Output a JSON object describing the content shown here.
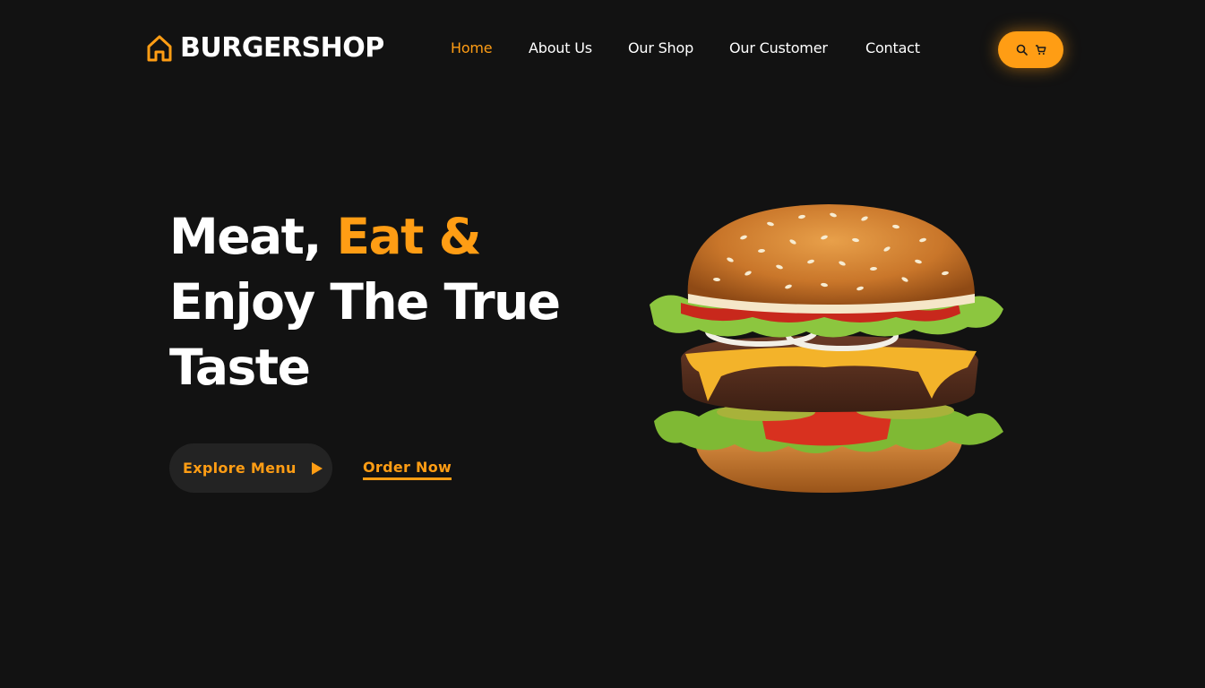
{
  "brand": {
    "name": "BURGERSHOP",
    "icon": "home-icon",
    "accent_color": "#ff9d14"
  },
  "nav": {
    "items": [
      {
        "label": "Home",
        "active": true
      },
      {
        "label": "About Us",
        "active": false
      },
      {
        "label": "Our Shop",
        "active": false
      },
      {
        "label": "Our Customer",
        "active": false
      },
      {
        "label": "Contact",
        "active": false
      }
    ]
  },
  "actions": {
    "icons": [
      "search-icon",
      "cart-icon"
    ]
  },
  "hero": {
    "title_part1": "Meat, ",
    "title_accent": "Eat &",
    "title_line2": "Enjoy The True",
    "title_line3": "Taste",
    "explore_label": "Explore Menu",
    "order_label": "Order Now"
  },
  "colors": {
    "background": "#121212",
    "accent": "#ff9d14",
    "button_dark": "#232323"
  }
}
